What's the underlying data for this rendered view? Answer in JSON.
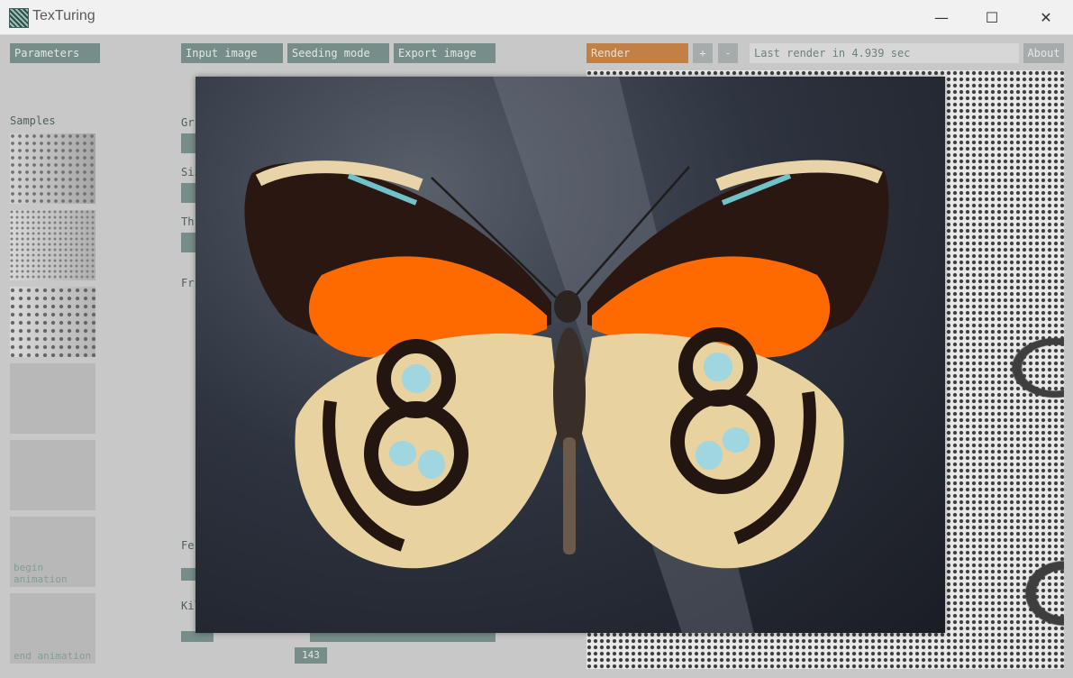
{
  "window": {
    "title": "TexTuring",
    "minimize_glyph": "—",
    "maximize_glyph": "☐",
    "close_glyph": "✕"
  },
  "toolbar": {
    "parameters": "Parameters",
    "input_image": "Input image",
    "seeding_mode": "Seeding mode",
    "export_image": "Export image",
    "render": "Render",
    "plus": "+",
    "minus": "-",
    "last_render": "Last render in 4.939 sec",
    "about": "About"
  },
  "sidebar": {
    "samples_label": "Samples",
    "begin_animation": "begin animation",
    "end_animation": "end animation"
  },
  "params": {
    "gr_label": "Gr",
    "siz_label": "Siz",
    "thr_label": "Thr",
    "fr_label": "Fr",
    "fee_label": "Fe",
    "kill_label": "Kill",
    "value_143": "143"
  },
  "popup": {
    "subject": "butterfly-photo"
  },
  "colors": {
    "accent_teal": "#5b7a74",
    "render_orange": "#c0681a"
  }
}
